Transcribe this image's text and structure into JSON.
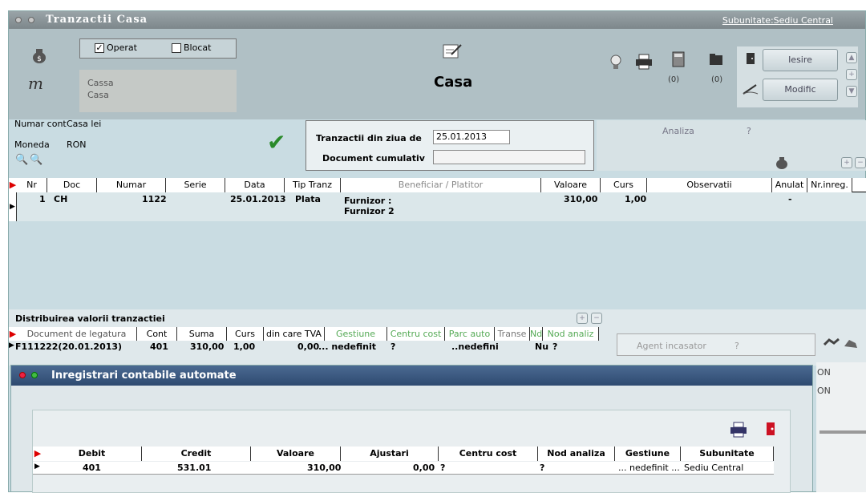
{
  "window": {
    "title": "Tranzactii Casa",
    "subunit_link": "Subunitate:Sediu Central"
  },
  "top": {
    "operat_label": "Operat",
    "blocat_label": "Blocat",
    "cassa_line1": "Cassa",
    "cassa_line2": "Casa",
    "form_title": "Casa",
    "counter1": "(0)",
    "counter2": "(0)",
    "iesire_label": "Iesire",
    "modific_label": "Modific"
  },
  "account": {
    "numar_cont_label": "Numar cont",
    "numar_cont_value": "Casa lei",
    "moneda_label": "Moneda",
    "moneda_value": "RON",
    "tranzactii_label": "Tranzactii din ziua de",
    "date_value": "25.01.2013",
    "cumulativ_label": "Document cumulativ",
    "analiza_label": "Analiza",
    "analiza_q": "?"
  },
  "main_table": {
    "headers": [
      "Nr",
      "Doc",
      "Numar",
      "Serie",
      "Data",
      "Tip Tranz",
      "Beneficiar / Platitor",
      "Valoare",
      "Curs",
      "Observatii",
      "Anulat",
      "Nr.inreg."
    ],
    "row": {
      "nr": "1",
      "doc": "CH",
      "numar": "1122",
      "serie": "",
      "data": "25.01.2013",
      "tip": "Plata",
      "benef1": "Furnizor :",
      "benef2": "Furnizor 2",
      "valoare": "310,00",
      "curs": "1,00",
      "observatii": "",
      "anulat": "-",
      "nrinreg": ""
    }
  },
  "distrib": {
    "title": "Distribuirea valorii tranzactiei",
    "headers": [
      "Document de legatura",
      "Cont",
      "Suma",
      "Curs",
      "din care TVA",
      "Gestiune",
      "Centru cost",
      "Parc auto",
      "Transe",
      "Nd",
      "Nod analiz"
    ],
    "row": {
      "doc": "F111222(20.01.2013)",
      "cont": "401",
      "suma": "310,00",
      "curs": "1,00",
      "tva": "0,00",
      "gestiune": "... nedefinit",
      "centru": "?",
      "parc": "..nedefini",
      "transe": "",
      "nd": "Nu",
      "nod": "?"
    },
    "agent_label": "Agent incasator",
    "agent_q": "?",
    "side1": "ON",
    "side2": "ON"
  },
  "popup": {
    "title": "Inregistrari contabile automate",
    "headers": [
      "Debit",
      "Credit",
      "Valoare",
      "Ajustari",
      "Centru cost",
      "Nod analiza",
      "Gestiune",
      "Subunitate"
    ],
    "row": {
      "debit": "401",
      "credit": "531.01",
      "valoare": "310,00",
      "ajustari": "0,00",
      "centru": "?",
      "nod": "?",
      "gestiune": "... nedefinit ...",
      "subunitate": "Sediu Central"
    }
  }
}
